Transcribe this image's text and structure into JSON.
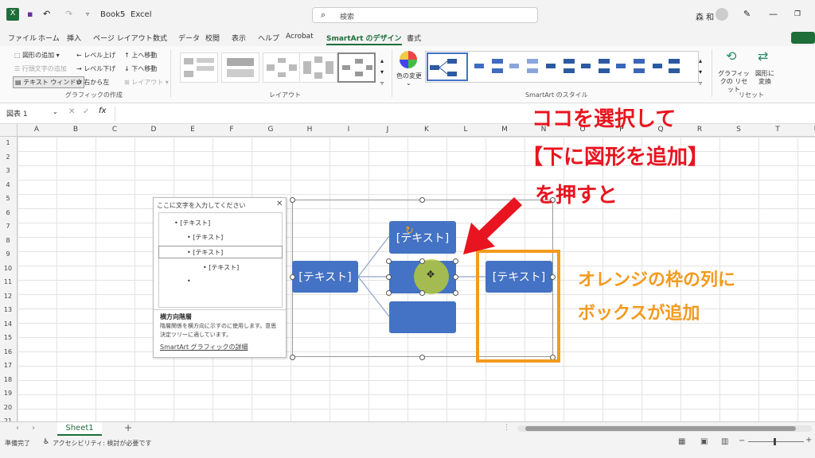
{
  "title": {
    "book": "Book5",
    "app": "Excel",
    "search_placeholder": "検索",
    "user": "森 和"
  },
  "menu": [
    "ファイル",
    "ホーム",
    "挿入",
    "ページ レイアウト",
    "数式",
    "データ",
    "校閲",
    "表示",
    "ヘルプ",
    "Acrobat",
    "SmartArt のデザイン",
    "書式"
  ],
  "ribbon": {
    "create": {
      "add_shape": "図形の追加",
      "add_bullet": "行頭文字の追加",
      "text_pane": "テキスト ウィンドウ",
      "promote": "レベル上げ",
      "demote": "レベル下げ",
      "right_to_left": "右から左",
      "move_up": "上へ移動",
      "move_down": "下へ移動",
      "layout_btn": "レイアウト",
      "group_label": "グラフィックの作成"
    },
    "layouts_label": "レイアウト",
    "change_colors": "色の変更",
    "styles_label": "SmartArt のスタイル",
    "reset_graphic": "グラフィックの リセット",
    "convert": "図形に 変換",
    "reset_label": "リセット"
  },
  "formula": {
    "namebox": "図表 1",
    "fx": "fx"
  },
  "columns": [
    "A",
    "B",
    "C",
    "D",
    "E",
    "F",
    "G",
    "H",
    "I",
    "J",
    "K",
    "L",
    "M",
    "N",
    "O",
    "P",
    "Q",
    "R",
    "S",
    "T",
    "U"
  ],
  "rows": [
    "1",
    "2",
    "3",
    "4",
    "5",
    "6",
    "7",
    "8",
    "9",
    "10",
    "11",
    "12",
    "13",
    "14",
    "15",
    "16",
    "17",
    "18",
    "19",
    "20",
    "21"
  ],
  "text_pane": {
    "title": "ここに文字を入力してください",
    "items": [
      "[テキスト]",
      "[テキスト]",
      "[テキスト]",
      "[テキスト]",
      ""
    ],
    "desc_title": "横方向階層",
    "desc_body": "階層関係を横方向に示すのに使用します。意思決定ツリーに適しています。",
    "link": "SmartArt グラフィックの詳細"
  },
  "smartart": {
    "root": "[テキスト]",
    "child1": "[テキスト]",
    "child2": "",
    "child3": "",
    "grandchild": "[テキスト]"
  },
  "annotation_red": [
    "ココを選択して",
    "【下に図形を追加】",
    "を押すと"
  ],
  "annotation_orange": [
    "オレンジの枠の列に",
    "ボックスが追加"
  ],
  "colors": {
    "accent_green": "#1e6e3a",
    "box_blue": "#4472c4",
    "arrow_red": "#e8141f",
    "frame_orange": "#f39a1e"
  },
  "sheet_tab": "Sheet1",
  "status": {
    "ready": "準備完了",
    "accessibility": "アクセシビリティ: 検討が必要です"
  }
}
